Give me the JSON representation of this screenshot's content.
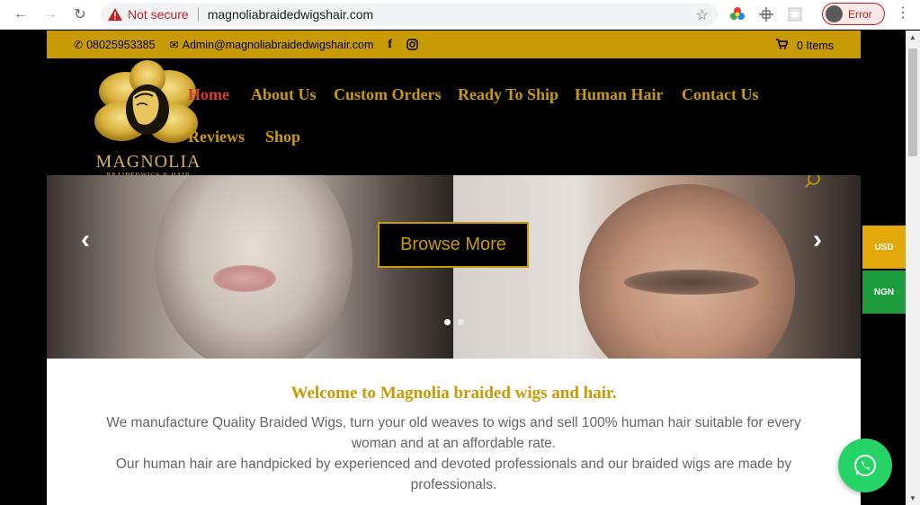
{
  "browser": {
    "security_label": "Not secure",
    "url": "magnoliabraidedwigshair.com",
    "profile_label": "Error"
  },
  "topbar": {
    "phone": "08025953385",
    "email": "Admin@magnoliabraidedwigshair.com",
    "cart": "0 Items"
  },
  "logo": {
    "name": "MAGNOLIA",
    "tagline": "BRAIDEDWIGS & HAIR"
  },
  "nav": {
    "items": [
      {
        "label": "Home"
      },
      {
        "label": "About Us"
      },
      {
        "label": "Custom Orders"
      },
      {
        "label": "Ready To Ship"
      },
      {
        "label": "Human Hair"
      },
      {
        "label": "Contact Us"
      },
      {
        "label": "Reviews"
      },
      {
        "label": "Shop"
      }
    ]
  },
  "slider": {
    "button_label": "Browse More",
    "prev_arrow": "‹",
    "next_arrow": "›"
  },
  "content": {
    "heading": "Welcome to Magnolia braided wigs and hair.",
    "paragraph_1": "We manufacture Quality Braided Wigs, turn your old weaves to wigs and sell 100% human hair suitable for every woman and at an affordable rate.",
    "paragraph_2": "Our human hair are handpicked by experienced and devoted professionals and our braided wigs are made by professionals."
  },
  "currency": {
    "usd": "USD",
    "ngn": "NGN"
  },
  "colors": {
    "brand_gold": "#c89a03",
    "active_nav": "#d73a2f",
    "usd_bg": "#e3a90b",
    "ngn_bg": "#1e9d3d",
    "whatsapp": "#25d366"
  }
}
